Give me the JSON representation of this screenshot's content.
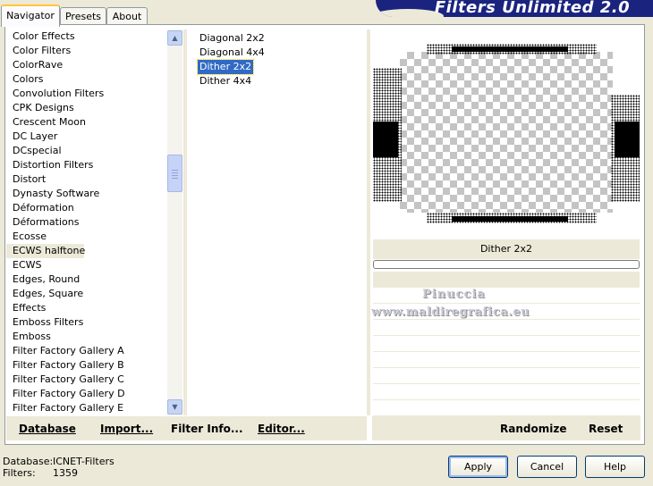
{
  "tabs": [
    "Navigator",
    "Presets",
    "About"
  ],
  "banner_title": "Filters Unlimited 2.0",
  "categories": [
    "Color Effects",
    "Color Filters",
    "ColorRave",
    "Colors",
    "Convolution Filters",
    "CPK Designs",
    "Crescent Moon",
    "DC Layer",
    "DCspecial",
    "Distortion Filters",
    "Distort",
    "Dynasty Software",
    "Déformation",
    "Déformations",
    "Ecosse",
    "ECWS halftone",
    "ECWS",
    "Edges, Round",
    "Edges, Square",
    "Effects",
    "Emboss Filters",
    "Emboss",
    "Filter Factory Gallery A",
    "Filter Factory Gallery B",
    "Filter Factory Gallery C",
    "Filter Factory Gallery D",
    "Filter Factory Gallery E"
  ],
  "selected_category": "ECWS halftone",
  "filters": [
    "Diagonal 2x2",
    "Diagonal 4x4",
    "Dither 2x2",
    "Dither 4x4"
  ],
  "selected_filter": "Dither 2x2",
  "preview_label": "Dither 2x2",
  "watermark": [
    "Pinuccia",
    "www.maldiregrafica.eu"
  ],
  "bottom_left_buttons": {
    "database": "Database",
    "import": "Import...",
    "filter_info": "Filter Info...",
    "editor": "Editor..."
  },
  "bottom_right_buttons": {
    "randomize": "Randomize",
    "reset": "Reset"
  },
  "status": {
    "database_label": "Database:",
    "database_value": "ICNET-Filters",
    "filters_label": "Filters:",
    "filters_value": "1359"
  },
  "dialog_buttons": {
    "apply": "Apply",
    "cancel": "Cancel",
    "help": "Help"
  }
}
